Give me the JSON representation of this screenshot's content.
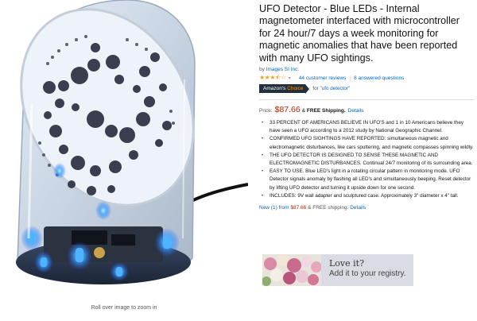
{
  "product": {
    "title": "UFO Detector - Blue LEDs - Internal magnetometer interfaced with microcontroller for 24 hour/7 days a week monitoring for magnetic anomalies that have been reported with many UFO sightings.",
    "byline_prefix": "by",
    "brand": "Images SI Inc.",
    "rating_stars": 3.5,
    "reviews_count": "44 customer reviews",
    "answered_questions": "8 answered questions",
    "badge_amazons": "Amazon's",
    "badge_choice": "Choice",
    "choice_for": "for",
    "choice_query": "\"ufo detector\""
  },
  "price": {
    "label": "Price:",
    "amount": "$87.66",
    "amp": "&",
    "free_shipping": "FREE Shipping.",
    "details": "Details"
  },
  "bullets": [
    "33 PERCENT OF AMERICANS BELIEVE IN UFO'S and 1 in 10 Americans believe they have seen a UFO according to a 2012 study by National Geographic Channel.",
    "CONFIRMED UFO SIGHTINGS HAVE REPORTED: simultaneous magnetic and electromagnetic disturbances, like cars sputtering, and magnetic compasses spinning wildly.",
    "THE UFO DETECTOR IS DESIGNED TO SENSE THESE MAGNETIC AND ELECTROMAGNETIC DISTURBANCES. Continual 24/7 monitoring of its surrounding area.",
    "EASY TO USE. Blue LED's light in a rotating circular pattern in monitoring mode. UFO Detector signals anomaly by flashing all LED's and simultaneously beeping. Reset detector by lifting UFO detector and turning it upside down for one second.",
    "INCLUDES: 9V wall adapter and sculptured case. Approximately 3\" diameter x 4\" tall."
  ],
  "new_offer": {
    "link": "New (1) from",
    "price": "$87.66",
    "rest": "& FREE shipping.",
    "details": "Details"
  },
  "registry": {
    "line1": "Love it?",
    "line2": "Add it to your registry."
  },
  "image": {
    "zoom_hint": "Roll over image to zoom in"
  },
  "colors": {
    "link": "#0066c0",
    "price": "#b12704",
    "star": "#f0a01f",
    "badge_bg": "#232f3e",
    "badge_accent": "#ff9900"
  }
}
